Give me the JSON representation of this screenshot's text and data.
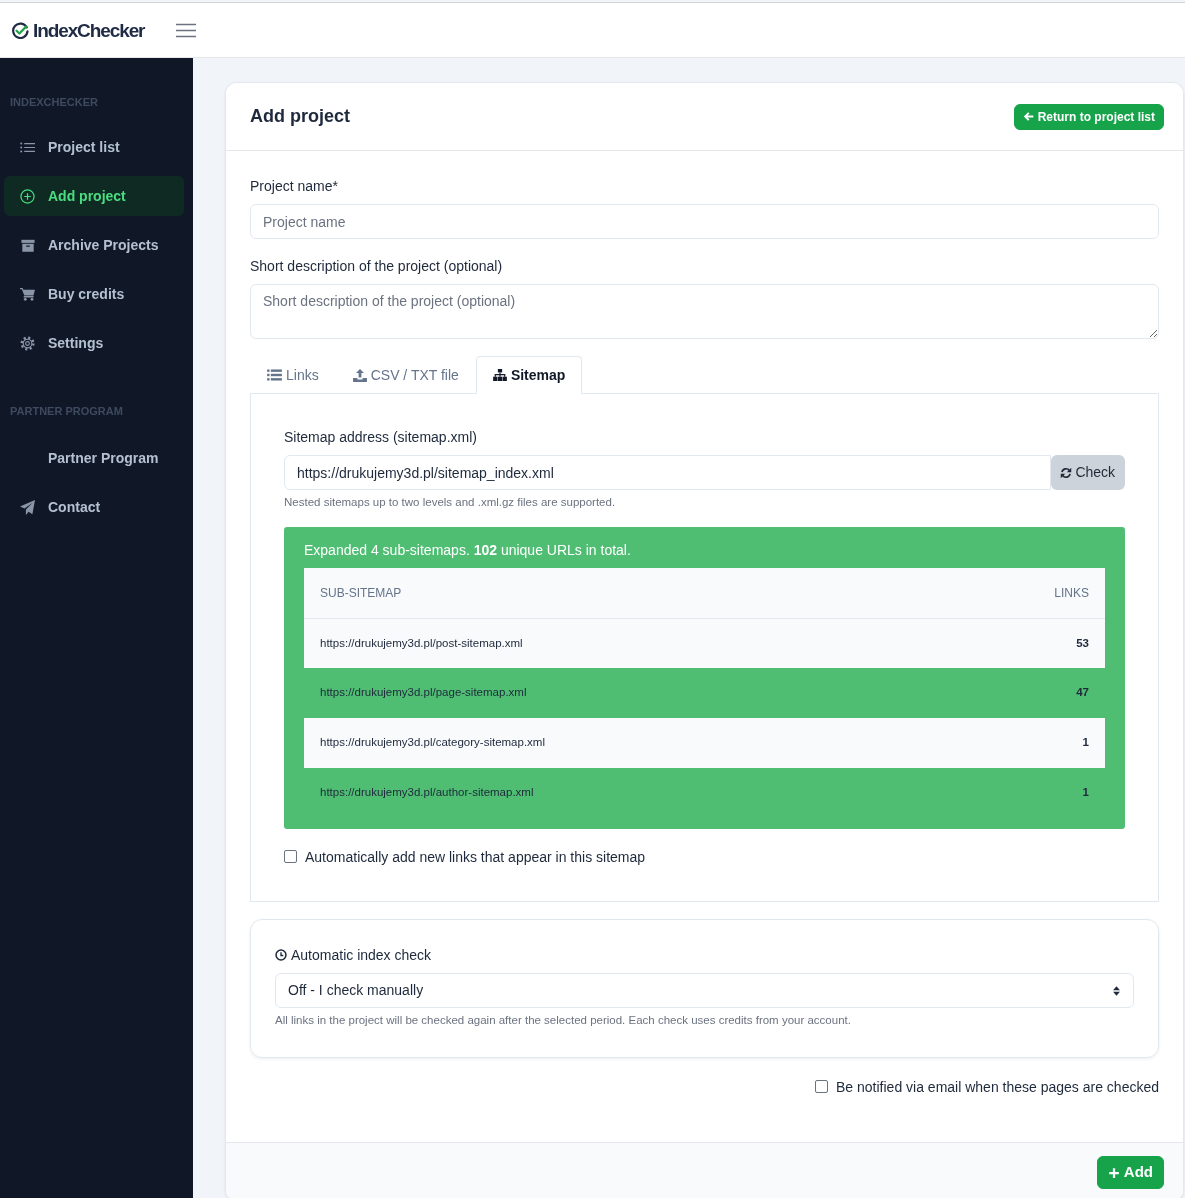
{
  "topbar": {
    "logo": "IndexChecker"
  },
  "sidebar": {
    "sections": [
      {
        "title": "INDEXCHECKER",
        "items": [
          {
            "label": "Project list",
            "selected": false
          },
          {
            "label": "Add project",
            "selected": true
          },
          {
            "label": "Archive Projects",
            "selected": false
          },
          {
            "label": "Buy credits",
            "selected": false
          },
          {
            "label": "Settings",
            "selected": false
          }
        ]
      },
      {
        "title": "PARTNER PROGRAM",
        "items": [
          {
            "label": "Partner Program",
            "selected": false
          },
          {
            "label": "Contact",
            "selected": false
          }
        ]
      }
    ]
  },
  "card": {
    "title": "Add project",
    "return_button": "Return to project list",
    "fields": [
      {
        "kind": "input",
        "label": "Project name*",
        "placeholder": "Project name"
      },
      {
        "kind": "textarea",
        "label": "Short description of the project (optional)",
        "placeholder": "Short description of the project (optional)"
      }
    ],
    "tabs": [
      {
        "label": "Links",
        "selected": false
      },
      {
        "label": "CSV / TXT file",
        "selected": false
      },
      {
        "label": "Sitemap",
        "selected": true
      }
    ],
    "sitemap": {
      "label": "Sitemap address (sitemap.xml)",
      "value": "https://drukujemy3d.pl/sitemap_index.xml",
      "check_button": "Check",
      "help": "Nested sitemaps up to two levels and .xml.gz files are supported.",
      "result": {
        "message": "Expanded 4 sub-sitemaps. **102** unique URLs in total.",
        "columns": [
          "SUB-SITEMAP",
          "LINKS"
        ],
        "rows": [
          {
            "url": "https://drukujemy3d.pl/post-sitemap.xml",
            "links": "53"
          },
          {
            "url": "https://drukujemy3d.pl/page-sitemap.xml",
            "links": "47"
          },
          {
            "url": "https://drukujemy3d.pl/category-sitemap.xml",
            "links": "1"
          },
          {
            "url": "https://drukujemy3d.pl/author-sitemap.xml",
            "links": "1"
          }
        ]
      },
      "auto_add": {
        "label": "Automatically add new links that appear in this sitemap",
        "checked": false
      }
    },
    "index_check": {
      "label": "Automatic index check",
      "value": "Off - I check manually",
      "help": "All links in the project will be checked again after the selected period. Each check uses credits from your account."
    },
    "notify": {
      "label": "Be notified via email when these pages are checked",
      "checked": false
    },
    "add_button": "Add"
  }
}
